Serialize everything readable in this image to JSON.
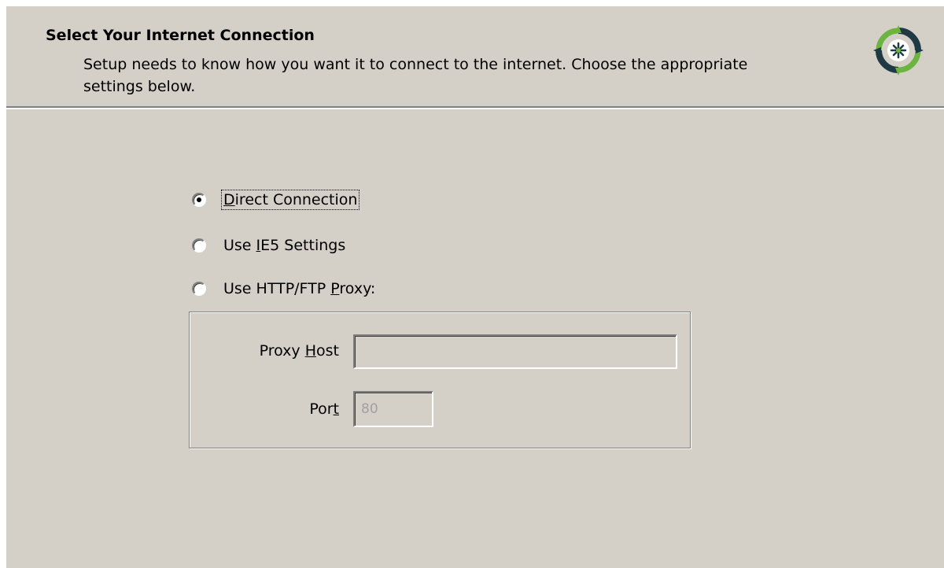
{
  "header": {
    "title": "Select Your Internet Connection",
    "description": "Setup needs to know how you want it to connect to the internet.  Choose the appropriate settings below.",
    "logo_icon": "compass-logo-icon"
  },
  "connection_options": [
    {
      "label_prefix": "",
      "mnemonic": "D",
      "label_suffix": "irect Connection",
      "selected": true
    },
    {
      "label_prefix": "Use ",
      "mnemonic": "I",
      "label_suffix": "E5 Settings",
      "selected": false
    },
    {
      "label_prefix": "Use HTTP/FTP ",
      "mnemonic": "P",
      "label_suffix": "roxy:",
      "selected": false
    }
  ],
  "proxy": {
    "host_label_prefix": "Proxy ",
    "host_label_mnemonic": "H",
    "host_label_suffix": "ost",
    "host_value": "",
    "port_label_prefix": "Por",
    "port_label_mnemonic": "t",
    "port_label_suffix": "",
    "port_value": "80",
    "enabled": false
  },
  "colors": {
    "dialog_background": "#d4d0c8",
    "logo_green": "#6db33f",
    "logo_navy": "#1f3a44"
  }
}
